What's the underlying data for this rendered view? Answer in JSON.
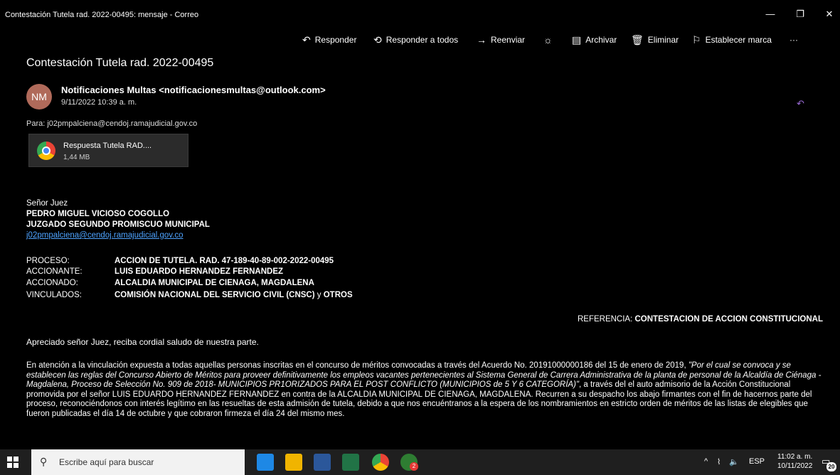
{
  "window": {
    "title": "Contestación Tutela rad. 2022-00495: mensaje - Correo",
    "controls": {
      "minimize": "—",
      "restore": "❐",
      "close": "✕"
    }
  },
  "toolbar": {
    "reply": "Responder",
    "reply_all": "Responder a todos",
    "forward": "Reenviar",
    "archive": "Archivar",
    "delete": "Eliminar",
    "flag": "Establecer marca",
    "more": "···"
  },
  "message": {
    "subject": "Contestación Tutela rad. 2022-00495",
    "avatar_initials": "NM",
    "sender": "Notificaciones Multas <notificacionesmultas@outlook.com>",
    "date": "9/11/2022 10:39 a. m.",
    "to": "Para: j02pmpalciena@cendoj.ramajudicial.gov.co",
    "attachment": {
      "name": "Respuesta Tutela RAD....",
      "size": "1,44 MB"
    }
  },
  "letter": {
    "salutation": "Señor Juez",
    "judge": "PEDRO MIGUEL VICIOSO COGOLLO",
    "court": "JUZGADO SEGUNDO PROMISCUO MUNICIPAL",
    "email": "j02pmpalciena@cendoj.ramajudicial.gov.co",
    "proceso_label": "PROCESO:",
    "proceso": "ACCION DE TUTELA. RAD.  47-189-40-89-002-2022-00495",
    "accionante_label": "ACCIONANTE:",
    "accionante": "LUIS EDUARDO HERNANDEZ FERNANDEZ",
    "accionado_label": "ACCIONADO:",
    "accionado": "ALCALDIA MUNICIPAL DE CIENAGA, MAGDALENA",
    "vinculados_label": "VINCULADOS:",
    "vinculados_a": "COMISIÓN NACIONAL DEL SERVICIO CIVIL (CNSC)",
    "vinculados_y": " y ",
    "vinculados_b": "OTROS",
    "ref_label": "REFERENCIA: ",
    "ref_value": "CONTESTACION DE ACCION CONSTITUCIONAL",
    "greeting": "Apreciado señor Juez, reciba cordial saludo de nuestra parte.",
    "p1_a": "En atención a la vinculación expuesta a todas aquellas personas inscritas en el concurso de méritos convocadas a través del Acuerdo No. 20191000000186 del 15 de enero de 2019, ",
    "p1_b": "\"Por el cual se convoca y se establecen las reglas del Concurso Abierto de Méritos para proveer definitivamente los empleos vacantes pertenecientes al Sistema General de Carrera Administrativa de la planta de personal de la Alcaldía de Ciénaga - Magdalena, Proceso de Selección No. 909 de 2018- MUNICIPIOS PR1ORIZADOS PARA EL POST CONFLICTO (MUNICIPIOS de 5 Y 6 CATEGORÍA)\"",
    "p1_c": ", a través del el auto admisorio de la Acción Constitucional promovida por el señor LUIS EDUARDO HERNANDEZ FERNANDEZ  en contra de la ALCALDIA MUNICIPAL DE CIENAGA, MAGDALENA. Recurren a su despacho los abajo firmantes con el fin de hacernos parte del proceso, reconociéndonos con interés legítimo en las resueltas de esta admisión de tutela, debido a que nos encuéntranos a la espera de los nombramientos en estricto orden de méritos de las listas de elegibles que fueron publicadas el día 14 de octubre y que cobraron firmeza el día 24 del mismo mes."
  },
  "taskbar": {
    "search_placeholder": "Escribe aquí para buscar",
    "lang": "ESP",
    "time": "11:02 a. m.",
    "date": "10/11/2022",
    "notif_count": "20",
    "chat_badge": "2"
  }
}
